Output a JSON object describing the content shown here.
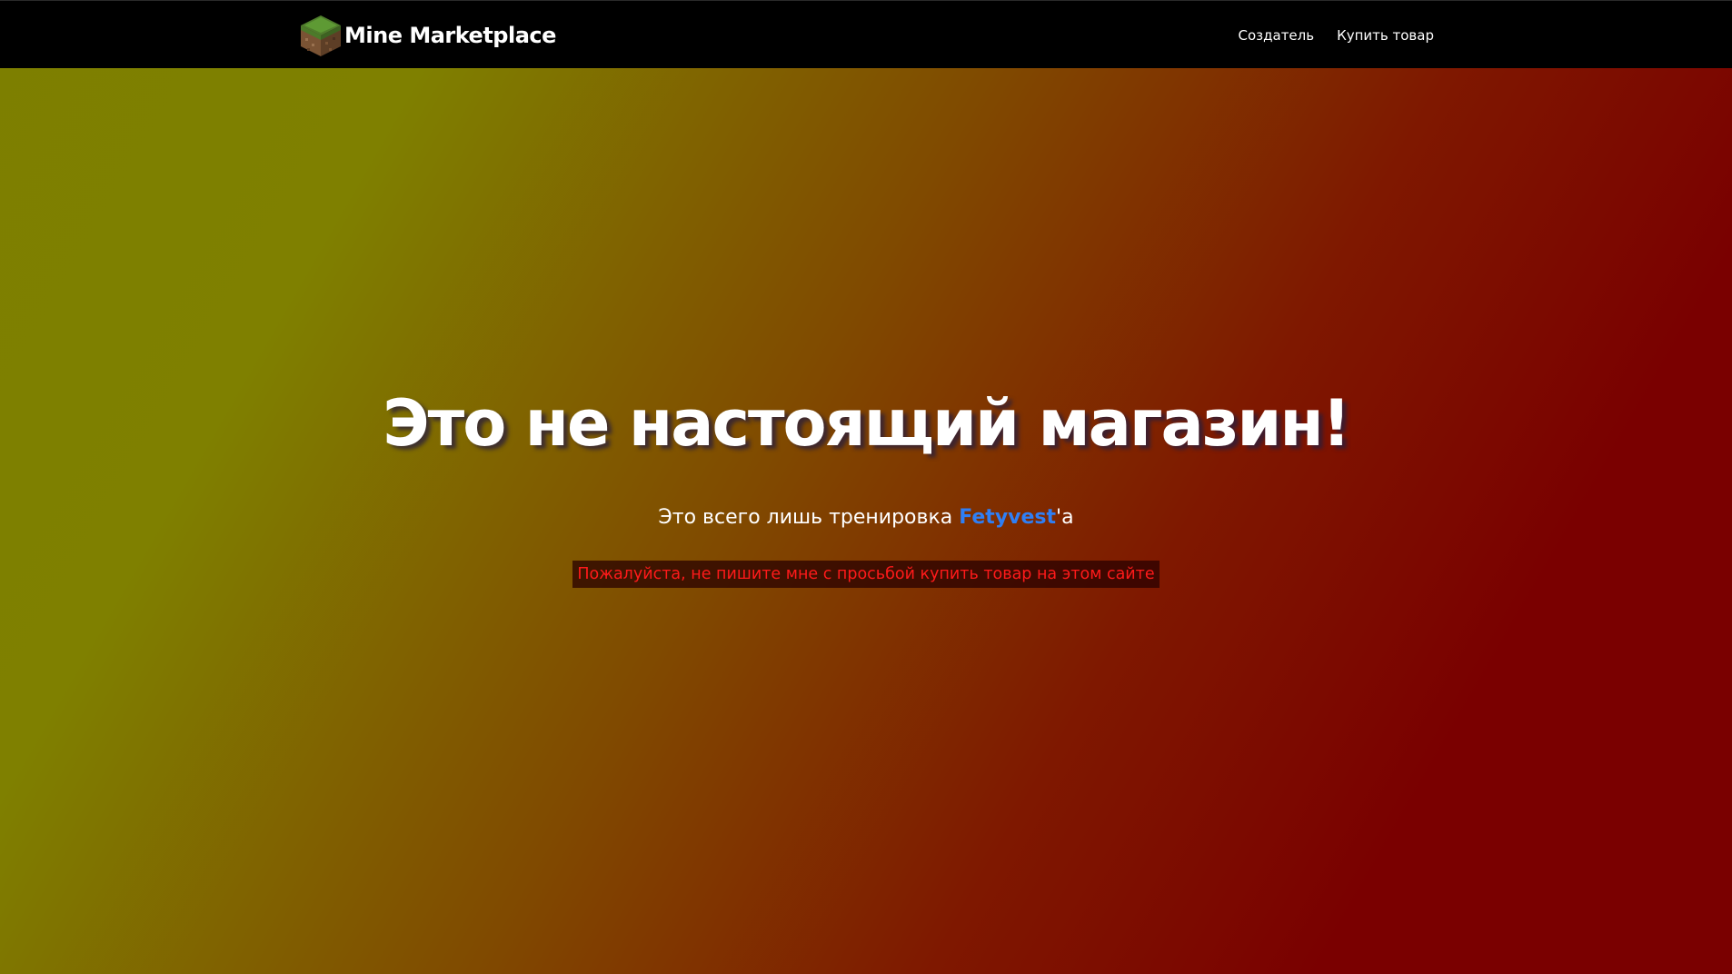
{
  "navbar": {
    "brand": {
      "name": "Mine Marketplace",
      "logo_icon": "grass-block-icon"
    },
    "links": [
      {
        "label": "Создатель"
      },
      {
        "label": "Купить товар"
      }
    ]
  },
  "hero": {
    "title": "Это не настоящий магазин!",
    "subtitle": {
      "prefix": "Это всего лишь тренировка ",
      "author": "Fetyvest",
      "suffix": "'a"
    },
    "warning": "Пожалуйста, не пишите мне с просьбой купить товар на этом сайте"
  },
  "colors": {
    "navbar_bg": "#000000",
    "gradient_start": "#7f8000",
    "gradient_end": "#7a0000",
    "author_link": "#2f7ff5",
    "warning_text": "#ff1a1a"
  }
}
